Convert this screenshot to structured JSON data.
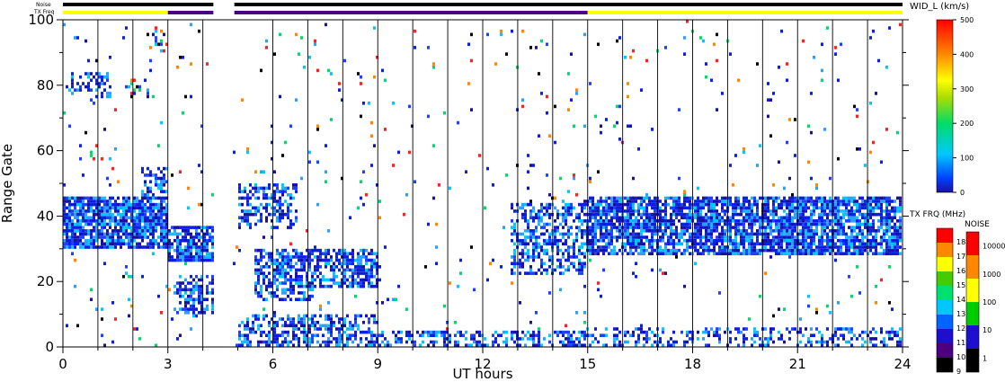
{
  "chart_data": {
    "type": "heatmap",
    "xlabel": "UT hours",
    "ylabel": "Range Gate",
    "xlim": [
      0,
      24
    ],
    "ylim": [
      0,
      100
    ],
    "xticks": [
      0,
      3,
      6,
      9,
      12,
      15,
      18,
      21,
      24
    ],
    "yticks": [
      0,
      20,
      40,
      60,
      80,
      100
    ],
    "status_bars": {
      "noise_label": "Noise",
      "txfreq_label": "TX Freq",
      "noise_segments": [
        {
          "x0": 0,
          "x1": 4.3,
          "color": "#000000"
        },
        {
          "x0": 4.9,
          "x1": 24,
          "color": "#000000"
        }
      ],
      "txfreq_segments": [
        {
          "x0": 0,
          "x1": 3.0,
          "color": "#ffff00"
        },
        {
          "x0": 3.0,
          "x1": 4.3,
          "color": "#4b0082"
        },
        {
          "x0": 4.9,
          "x1": 15.0,
          "color": "#4b0082"
        },
        {
          "x0": 15.0,
          "x1": 24,
          "color": "#ffff00"
        }
      ]
    },
    "vertical_gridlines_hours": [
      1,
      2,
      3,
      4,
      6,
      7,
      8,
      9,
      10,
      11,
      12,
      13,
      14,
      15,
      16,
      17,
      18,
      19,
      20,
      21,
      22,
      23
    ],
    "data_gap_hours": [
      4.3,
      4.9
    ],
    "dense_regions": [
      {
        "x0": 0.0,
        "x1": 3.0,
        "g0": 30,
        "g1": 46,
        "density": 0.85
      },
      {
        "x0": 2.2,
        "x1": 3.0,
        "g0": 40,
        "g1": 55,
        "density": 0.5
      },
      {
        "x0": 0.1,
        "x1": 1.4,
        "g0": 76,
        "g1": 84,
        "density": 0.35
      },
      {
        "x0": 1.8,
        "x1": 2.5,
        "g0": 76,
        "g1": 82,
        "density": 0.3
      },
      {
        "x0": 2.6,
        "x1": 3.0,
        "g0": 90,
        "g1": 100,
        "density": 0.3
      },
      {
        "x0": 3.0,
        "x1": 4.3,
        "g0": 26,
        "g1": 37,
        "density": 0.8
      },
      {
        "x0": 3.2,
        "x1": 4.3,
        "g0": 10,
        "g1": 22,
        "density": 0.55
      },
      {
        "x0": 5.0,
        "x1": 6.7,
        "g0": 36,
        "g1": 50,
        "density": 0.5
      },
      {
        "x0": 5.5,
        "x1": 9.0,
        "g0": 18,
        "g1": 30,
        "density": 0.65
      },
      {
        "x0": 5.5,
        "x1": 7.2,
        "g0": 14,
        "g1": 20,
        "density": 0.55
      },
      {
        "x0": 5.0,
        "x1": 9.0,
        "g0": 0,
        "g1": 10,
        "density": 0.5
      },
      {
        "x0": 9.0,
        "x1": 15.0,
        "g0": 0,
        "g1": 5,
        "density": 0.45
      },
      {
        "x0": 12.8,
        "x1": 15.0,
        "g0": 22,
        "g1": 44,
        "density": 0.55
      },
      {
        "x0": 15.0,
        "x1": 24.0,
        "g0": 28,
        "g1": 46,
        "density": 0.8
      },
      {
        "x0": 15.0,
        "x1": 24.0,
        "g0": 0,
        "g1": 6,
        "density": 0.35
      }
    ],
    "vel_colorbar": {
      "label": "WID_L (km/s)",
      "min": 0,
      "max": 500,
      "ticks": [
        0,
        100,
        200,
        300,
        400,
        500
      ]
    },
    "freq_colorbar": {
      "label": "TX FRQ (MHz)",
      "ticks": [
        9,
        10,
        11,
        12,
        13,
        14,
        15,
        16,
        17,
        18
      ],
      "colors": [
        "#000000",
        "#4b0082",
        "#1e0fd0",
        "#0064ff",
        "#00c8ff",
        "#00e070",
        "#44cc00",
        "#ffff00",
        "#ff8800",
        "#ff0000"
      ]
    },
    "noise_colorbar": {
      "label": "NOISE",
      "ticks": [
        "1",
        "10",
        "100",
        "1000",
        "10000"
      ],
      "colors": [
        "#000000",
        "#1e0fd0",
        "#00cc00",
        "#ffff00",
        "#ff8800",
        "#ff0000"
      ]
    },
    "point_palette": [
      "#0a1fe0",
      "#1e40ff",
      "#0a1fe0",
      "#2aa0ff",
      "#00c8ff",
      "#1a10a0",
      "#00dd66",
      "#ff2020",
      "#ff8800",
      "#000000"
    ]
  }
}
